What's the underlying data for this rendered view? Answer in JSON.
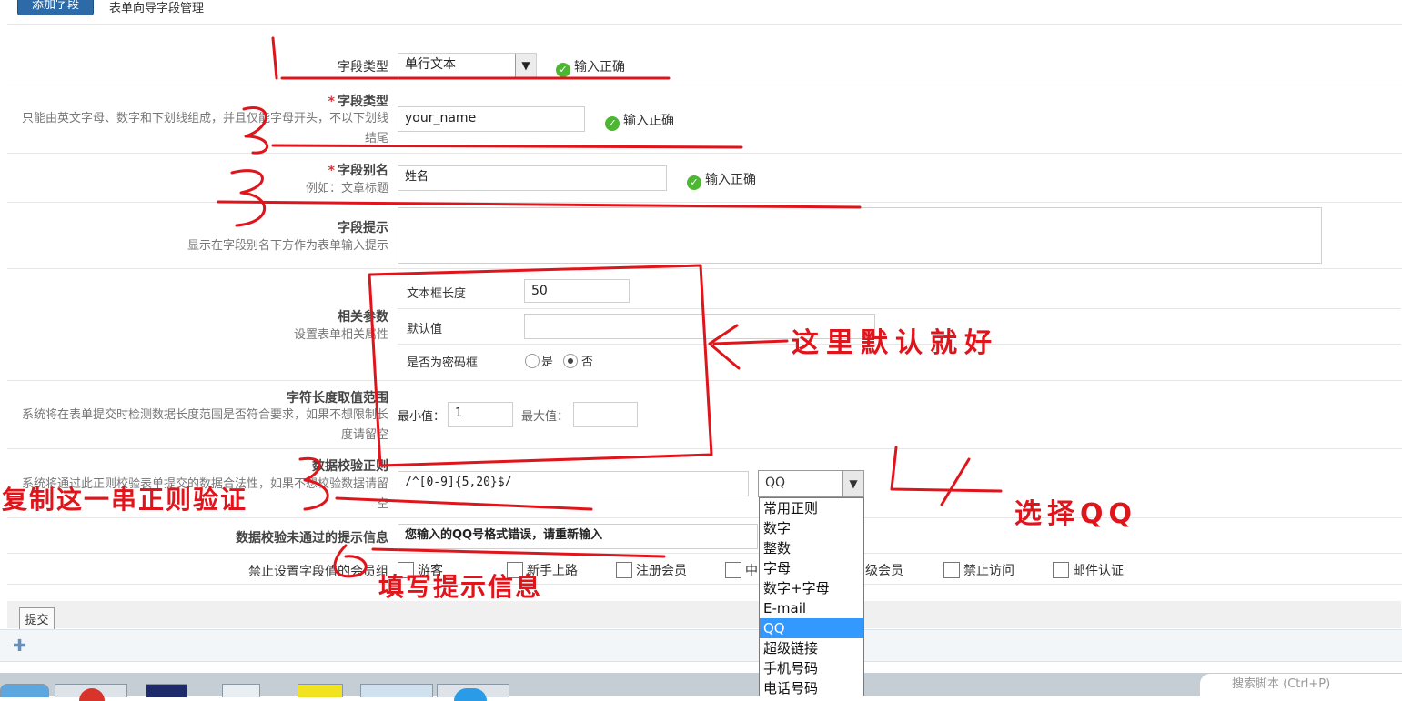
{
  "tabs": {
    "add_field": "添加字段",
    "guide_manage": "表单向导字段管理"
  },
  "form": {
    "field_type": {
      "label": "字段类型",
      "value": "单行文本",
      "ok": "输入正确"
    },
    "field_name": {
      "label": "字段类型",
      "hint": "只能由英文字母、数字和下划线组成，并且仅能字母开头，不以下划线结尾",
      "value": "your_name",
      "ok": "输入正确"
    },
    "field_alias": {
      "label": "字段别名",
      "hint": "例如：文章标题",
      "value": "姓名",
      "ok": "输入正确"
    },
    "field_tip": {
      "label": "字段提示",
      "hint": "显示在字段别名下方作为表单输入提示"
    },
    "params": {
      "label": "相关参数",
      "hint": "设置表单相关属性",
      "text_length_label": "文本框长度",
      "text_length_value": "50",
      "default_label": "默认值",
      "password_label": "是否为密码框",
      "yes": "是",
      "no": "否"
    },
    "length_range": {
      "label": "字符长度取值范围",
      "hint": "系统将在表单提交时检测数据长度范围是否符合要求，如果不想限制长度请留空",
      "min_label": "最小值：",
      "min_value": "1",
      "max_label": "最大值："
    },
    "regex": {
      "label": "数据校验正则",
      "hint": "系统将通过此正则校验表单提交的数据合法性，如果不想校验数据请留空",
      "value": "/^[0-9]{5,20}$/",
      "selected": "QQ",
      "options": [
        "常用正则",
        "数字",
        "整数",
        "字母",
        "数字+字母",
        "E-mail",
        "QQ",
        "超级链接",
        "手机号码",
        "电话号码"
      ]
    },
    "fail_msg": {
      "label": "数据校验未通过的提示信息",
      "value": "您输入的QQ号格式错误，请重新输入"
    },
    "forbid": {
      "label": "禁止设置字段值的会员组",
      "groups": [
        "游客",
        "新手上路",
        "注册会员",
        "中",
        "高级会员",
        "禁止访问",
        "邮件认证"
      ]
    },
    "submit": "提交"
  },
  "annotations": {
    "here_default": "这里默认就好",
    "copy_regex": "复制这一串正则验证",
    "choose_qq": "选择QQ",
    "fill_tip": "填写提示信息"
  },
  "taskbar": {
    "search_placeholder": "搜索脚本 (Ctrl+P)"
  },
  "colors": {
    "accent": "#2c6aa8",
    "annotation": "#e0151c",
    "ok": "#4cb832",
    "selected": "#3399ff"
  }
}
